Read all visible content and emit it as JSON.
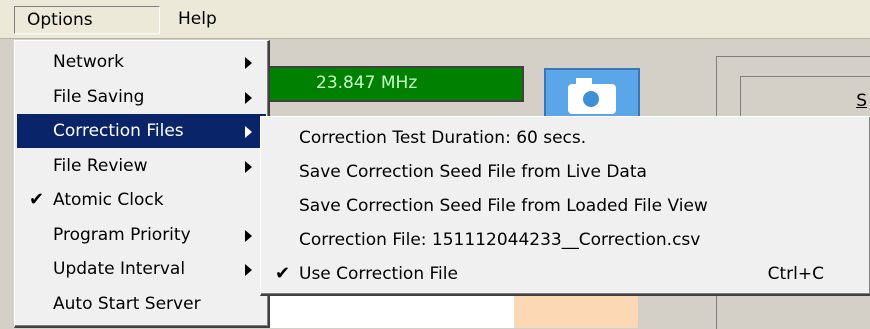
{
  "menubar": {
    "options": "Options",
    "help": "Help"
  },
  "frequency": "23.847 MHz",
  "right_panel_text": "S",
  "options_menu": {
    "items": [
      {
        "label": "Network",
        "submenu": true,
        "checked": false
      },
      {
        "label": "File Saving",
        "submenu": true,
        "checked": false
      },
      {
        "label": "Correction Files",
        "submenu": true,
        "checked": false,
        "highlighted": true
      },
      {
        "label": "File Review",
        "submenu": true,
        "checked": false
      },
      {
        "label": "Atomic Clock",
        "submenu": false,
        "checked": true
      },
      {
        "label": "Program Priority",
        "submenu": true,
        "checked": false
      },
      {
        "label": "Update Interval",
        "submenu": true,
        "checked": false
      },
      {
        "label": "Auto Start Server",
        "submenu": false,
        "checked": false
      }
    ]
  },
  "correction_menu": {
    "items": [
      {
        "label": "Correction Test Duration:  60 secs.",
        "checked": false,
        "shortcut": ""
      },
      {
        "label": "Save Correction Seed File from Live Data",
        "checked": false,
        "shortcut": ""
      },
      {
        "label": "Save Correction Seed File from Loaded File View",
        "checked": false,
        "shortcut": ""
      },
      {
        "label": "Correction File: 151112044233__Correction.csv",
        "checked": false,
        "shortcut": ""
      },
      {
        "label": "Use Correction File",
        "checked": true,
        "shortcut": "Ctrl+C"
      }
    ]
  },
  "check_glyph": "✔",
  "colors": {
    "highlight": "#0a246a",
    "freq_bg": "#008000",
    "freq_text": "#c8ffc8",
    "camera": "#5ba6e8",
    "peach": "#fcd8b4"
  }
}
